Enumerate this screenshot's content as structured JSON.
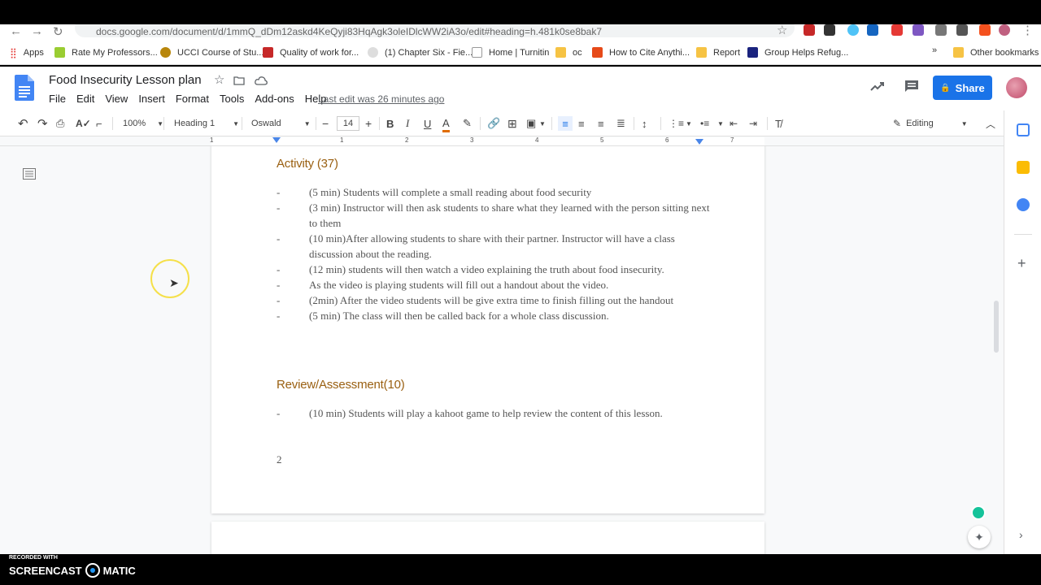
{
  "browser": {
    "url": "docs.google.com/document/d/1mmQ_dDm12askd4KeQyji83HqAgk3oleIDlcWW2iA3o/edit#heading=h.481k0se8bak7",
    "bookmarks": [
      "Apps",
      "Rate My Professors...",
      "UCCI Course of Stu...",
      "Quality of work for...",
      "(1) Chapter Six - Fie...",
      "Home | Turnitin",
      "oc",
      "How to Cite Anythi...",
      "Report",
      "Group Helps Refug...",
      "Other bookmarks"
    ],
    "more_label": "»"
  },
  "docs": {
    "title": "Food Insecurity Lesson plan",
    "menu": [
      "File",
      "Edit",
      "View",
      "Insert",
      "Format",
      "Tools",
      "Add-ons",
      "Help"
    ],
    "last_edit": "Last edit was 26 minutes ago",
    "share_label": "Share"
  },
  "toolbar": {
    "zoom": "100%",
    "style": "Heading 1",
    "font": "Oswald",
    "font_size": "14",
    "mode": "Editing"
  },
  "ruler": [
    "1",
    "1",
    "2",
    "3",
    "4",
    "5",
    "6",
    "7"
  ],
  "document": {
    "sections": [
      {
        "heading": "Activity (37)",
        "items": [
          "(5 min) Students will complete a small reading about food security",
          "(3 min) Instructor will then ask students to share what they learned with the person sitting next to them",
          "(10 min)After allowing students to share with their partner. Instructor will have a class discussion about the reading.",
          "(12 min) students will then watch a video explaining the truth about food insecurity.",
          "As the video is playing students will fill out a handout about the video.",
          "(2min) After the video students will be give extra time to finish filling out the handout",
          "(5 min) The class will then be called back for a whole class discussion."
        ]
      },
      {
        "heading": "Review/Assessment(10)",
        "items": [
          "(10 min) Students will play a kahoot game to help review the content of this lesson."
        ]
      }
    ],
    "page_number": "2",
    "bullet": "-"
  },
  "watermark": {
    "recorded": "RECORDED WITH",
    "brand_left": "SCREENCAST",
    "brand_right": "MATIC"
  }
}
